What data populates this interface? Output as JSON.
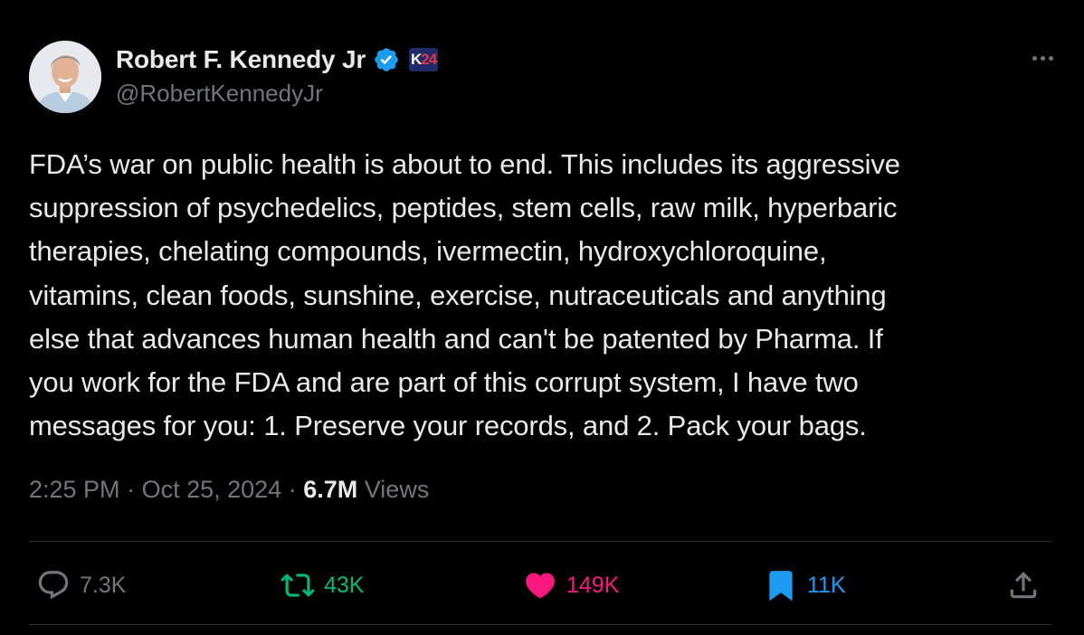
{
  "author": {
    "name": "Robert F. Kennedy Jr",
    "handle": "@RobertKennedyJr",
    "verified": true,
    "affiliate_badge": {
      "letter": "K",
      "number": "24"
    }
  },
  "tweet": {
    "text": "FDA’s war on public health is about to end. This includes its aggressive\nsuppression of psychedelics, peptides, stem cells, raw milk, hyperbaric\ntherapies, chelating compounds, ivermectin, hydroxychloroquine,\nvitamins, clean foods, sunshine, exercise, nutraceuticals and anything\nelse that advances human health and can't be patented by Pharma. If\nyou work for the FDA and are part of this corrupt system, I have two\nmessages for you: 1. Preserve your records, and 2. Pack your bags.",
    "time": "2:25 PM",
    "date": "Oct 25, 2024",
    "separator": "·",
    "views_count": "6.7M",
    "views_label": "Views"
  },
  "actions": {
    "replies": "7.3K",
    "reposts": "43K",
    "likes": "149K",
    "bookmarks": "11K"
  },
  "icons": {
    "verified": "verified-badge-icon",
    "more": "more-options-icon",
    "reply": "reply-icon",
    "repost": "repost-icon",
    "like": "heart-icon",
    "bookmark": "bookmark-icon",
    "share": "share-icon"
  },
  "colors": {
    "background": "#000000",
    "text_primary": "#e7e9ea",
    "text_secondary": "#71767b",
    "verified_blue": "#1d9bf0",
    "repost_green": "#00ba7c",
    "like_pink": "#f91880",
    "bookmark_blue": "#1d9bf0",
    "divider": "#2f3336"
  }
}
